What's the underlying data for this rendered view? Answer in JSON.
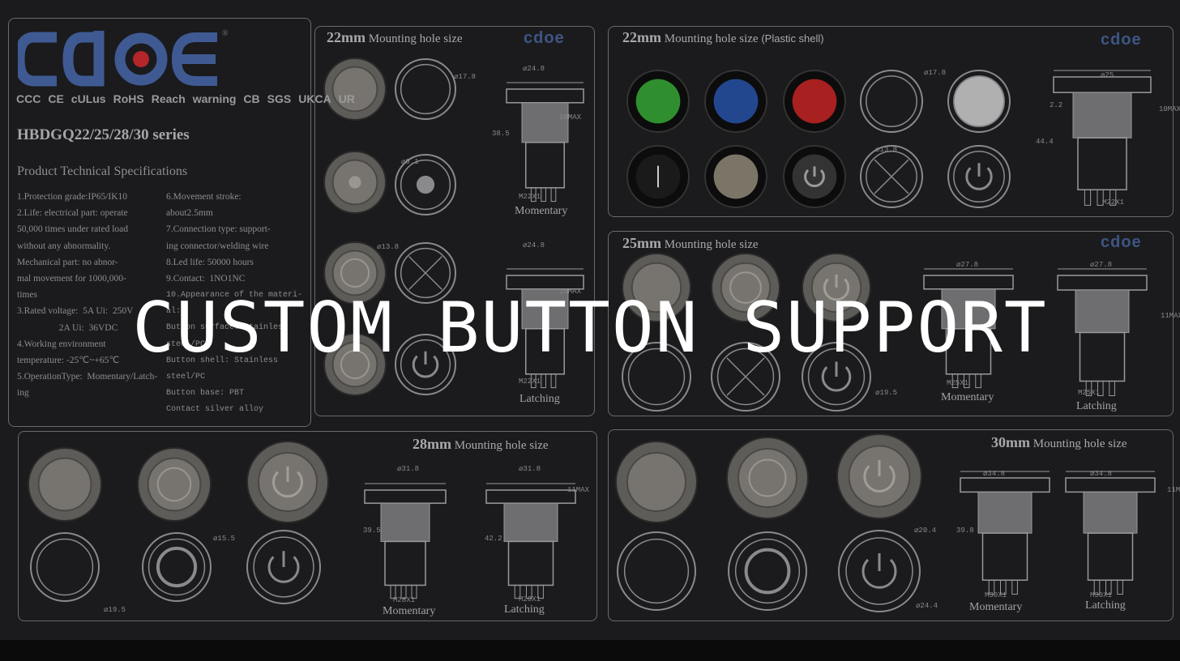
{
  "overlay_text": "CUSTOM BUTTON SUPPORT",
  "brand": {
    "name": "cdoe",
    "logo_blue": "#3f5a93",
    "logo_red": "#b3262a",
    "registered": "®"
  },
  "certifications": [
    "CCC",
    "CE",
    "cULus",
    "RoHS",
    "Reach",
    "warning",
    "CB",
    "SGS",
    "UKCA",
    "UR"
  ],
  "series": "HBDGQ22/25/28/30 series",
  "specs_title": "Product Technical Specifications",
  "specs_col1": "1.Protection grade:IP65/IK10\n2.Life: electrical part: operate\n50,000 times under rated load\nwithout any abnormality.\nMechanical part: no abnor-\nmal movement for 1000,000-\ntimes\n3.Rated voltage:  5A Ui:  250V\n                  2A Ui:  36VDC\n4.Working environment\ntemperature: -25℃~+65℃\n5.OperationType:  Momentary/Latch-\ning",
  "specs_col2": "6.Movement stroke:\nabout2.5mm\n7.Connection type: support-\ning connector/welding wire\n8.Led life: 50000 hours\n9.Contact:  1NO1NC",
  "specs_col2_mono": "10.Appearance of the materi-\nal:\nButton surface: Stainless\nsteel/PC\nButton shell: Stainless\nsteel/PC\nButton base: PBT\nContact silver alloy",
  "panels": {
    "p22": {
      "size": "22mm",
      "title": "Mounting hole size",
      "labels": [
        "Momentary",
        "Latching"
      ],
      "dims": [
        "⌀24.8",
        "38.5",
        "10MAX",
        "M22X1",
        "⌀24.8",
        "15MAX",
        "M22X1",
        "⌀17.8",
        "⌀9.1",
        "⌀13.8"
      ]
    },
    "p22p": {
      "size": "22mm",
      "title": "Mounting hole size",
      "note": "(Plastic shell)",
      "dims": [
        "⌀25",
        "2.2",
        "44.4",
        "10MAX",
        "M22X1",
        "⌀17.8",
        "⌀13.8"
      ]
    },
    "p25": {
      "size": "25mm",
      "title": "Mounting hole size",
      "labels": [
        "Momentary",
        "Latching"
      ],
      "dims": [
        "⌀27.8",
        "M25X1",
        "⌀27.8",
        "11MAX",
        "M25X1",
        "⌀19.5"
      ]
    },
    "p28": {
      "size": "28mm",
      "title": "Mounting hole size",
      "labels": [
        "Momentary",
        "Latching"
      ],
      "dims": [
        "⌀31.8",
        "39.5",
        "M28X1",
        "⌀31.8",
        "42.2",
        "11MAX",
        "M28X1",
        "⌀19.5",
        "⌀15.5"
      ]
    },
    "p30": {
      "size": "30mm",
      "title": "Mounting hole size",
      "labels": [
        "Momentary",
        "Latching"
      ],
      "dims": [
        "⌀34.8",
        "39.8",
        "M30X1",
        "⌀34.8",
        "11MAX",
        "M30X1",
        "⌀24.4",
        "⌀20.4"
      ]
    }
  },
  "colors": {
    "green": "#2f8f2f",
    "blue": "#23478f",
    "red": "#a82020",
    "white": "#b8b8b8"
  }
}
